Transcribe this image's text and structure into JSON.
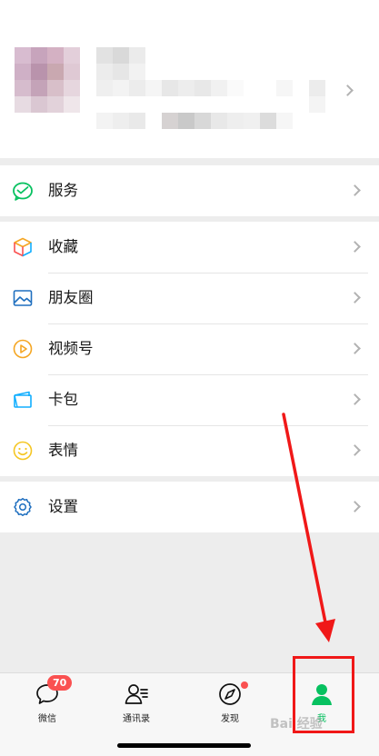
{
  "menu": {
    "services": "服务",
    "favorites": "收藏",
    "moments": "朋友圈",
    "channels": "视频号",
    "cards": "卡包",
    "stickers": "表情",
    "settings": "设置"
  },
  "tabs": {
    "chats": "微信",
    "chats_badge": "70",
    "contacts": "通讯录",
    "discover": "发现",
    "me": "我"
  },
  "watermark": "Bai 经验",
  "icons": {
    "services": "wechat-pay-icon",
    "favorites": "cube-icon",
    "moments": "photo-icon",
    "channels": "play-circle-icon",
    "cards": "wallet-icon",
    "stickers": "smiley-icon",
    "settings": "gear-icon",
    "chats": "chat-bubble-icon",
    "contacts": "contacts-icon",
    "discover": "compass-icon",
    "me": "person-icon"
  },
  "colors": {
    "accent_green": "#07c160",
    "badge_red": "#fa5151",
    "annotation_red": "#f01818",
    "background": "#ededed"
  }
}
